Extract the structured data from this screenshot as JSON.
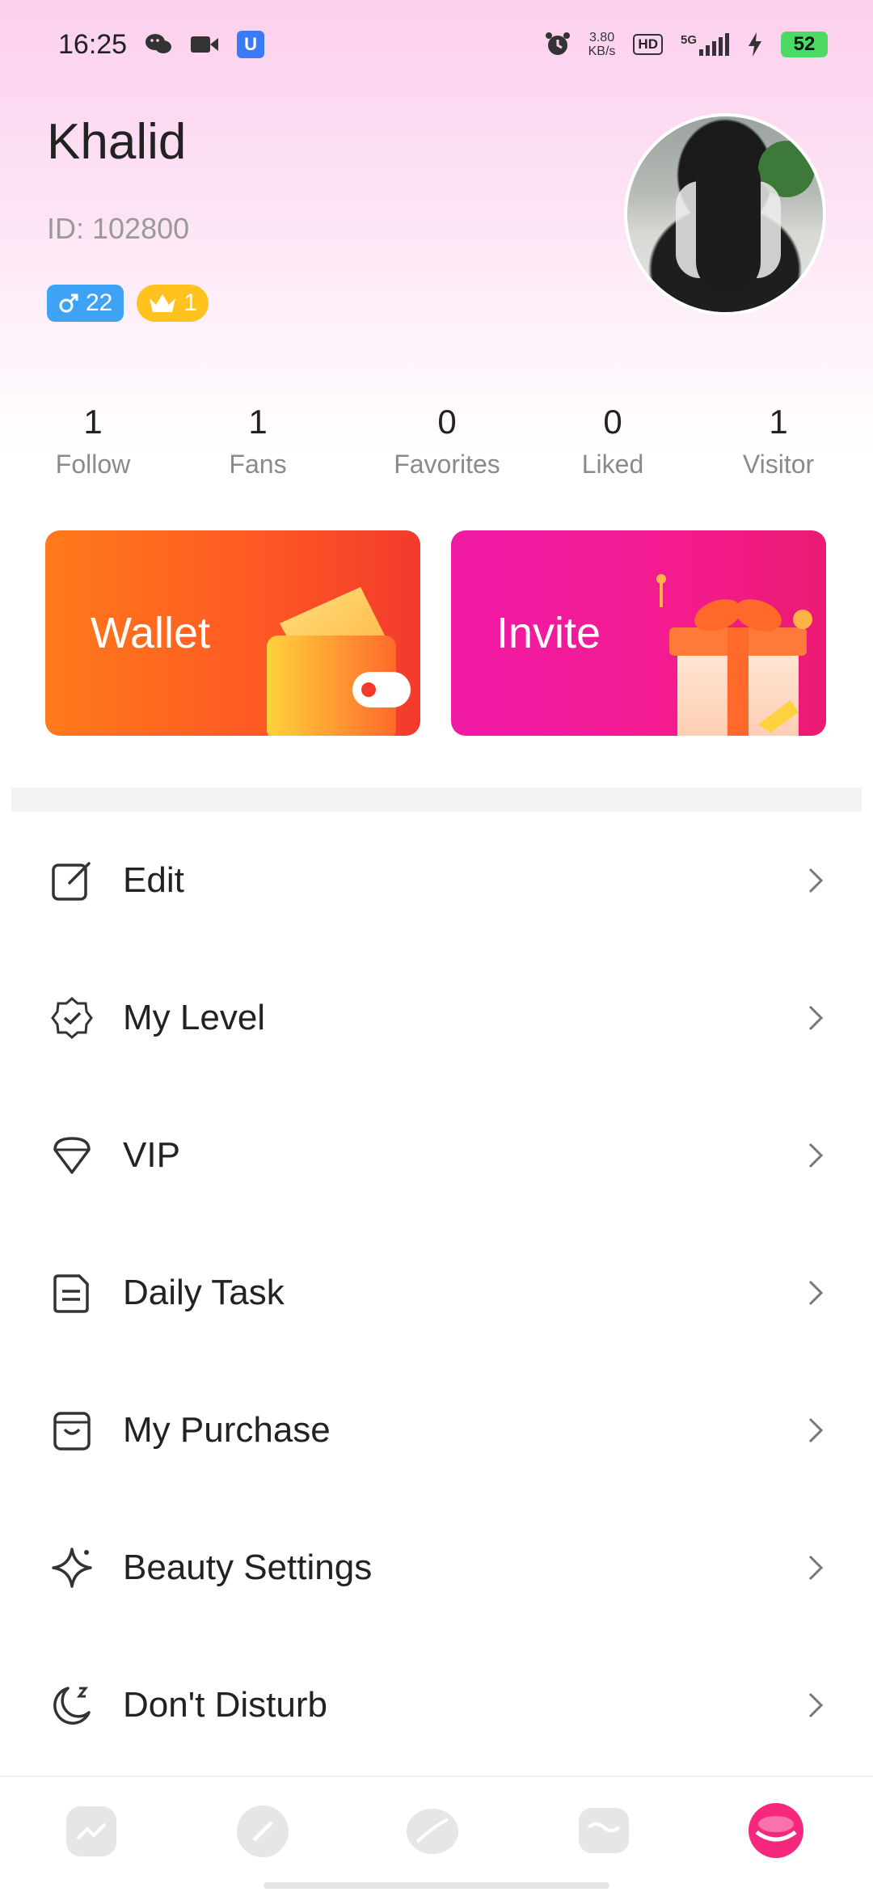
{
  "status_bar": {
    "time": "16:25",
    "network_speed_value": "3.80",
    "network_speed_unit": "KB/s",
    "hd_label": "HD",
    "signal_label": "5G",
    "battery": "52"
  },
  "profile": {
    "name": "Khalid",
    "id_text": "ID: 102800",
    "gender_age": "22",
    "vip_level": "1"
  },
  "stats": [
    {
      "value": "1",
      "label": "Follow"
    },
    {
      "value": "1",
      "label": "Fans"
    },
    {
      "value": "0",
      "label": "Favorites"
    },
    {
      "value": "0",
      "label": "Liked"
    },
    {
      "value": "1",
      "label": "Visitor"
    }
  ],
  "cards": {
    "wallet_label": "Wallet",
    "invite_label": "Invite"
  },
  "menu": [
    {
      "label": "Edit",
      "icon": "edit-icon"
    },
    {
      "label": "My Level",
      "icon": "level-badge-icon"
    },
    {
      "label": "VIP",
      "icon": "diamond-icon"
    },
    {
      "label": "Daily Task",
      "icon": "task-list-icon"
    },
    {
      "label": "My Purchase",
      "icon": "shopping-bag-icon"
    },
    {
      "label": "Beauty Settings",
      "icon": "sparkle-icon"
    },
    {
      "label": "Don't Disturb",
      "icon": "moon-icon"
    }
  ],
  "bottom_nav": {
    "items": [
      "home-icon",
      "explore-icon",
      "moments-icon",
      "messages-icon",
      "profile-icon"
    ],
    "active_index": 4,
    "active_color": "#f5287e",
    "inactive_color": "#e6e6e6"
  },
  "colors": {
    "wallet_start": "#ff7a1a",
    "invite_start": "#f01aa6",
    "gender_badge": "#3fa3f5",
    "level_badge": "#ffc21e"
  }
}
